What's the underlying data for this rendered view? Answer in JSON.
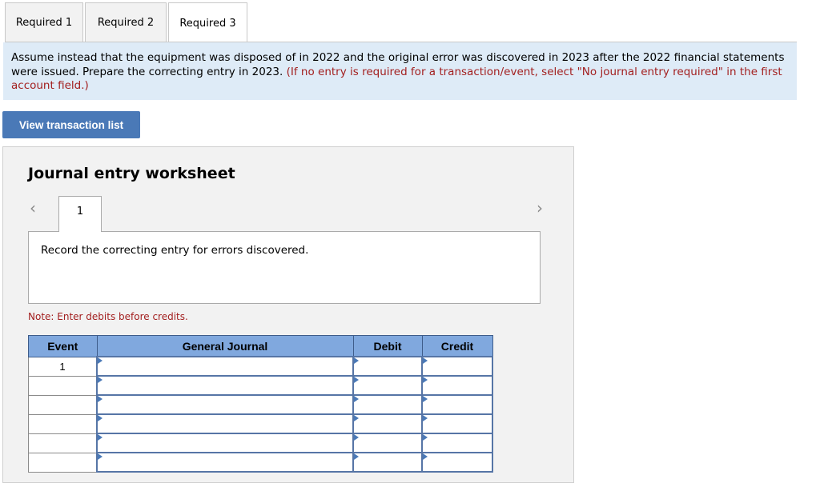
{
  "tabs": [
    {
      "label": "Required 1",
      "active": false
    },
    {
      "label": "Required 2",
      "active": false
    },
    {
      "label": "Required 3",
      "active": true
    }
  ],
  "instruction": {
    "text": "Assume instead that the equipment was disposed of in 2022 and the original error was discovered in 2023 after the 2022 financial statements were issued. Prepare the correcting entry in 2023.",
    "hint": "(If no entry is required for a transaction/event, select \"No journal entry required\" in the first account field.)"
  },
  "buttons": {
    "view_transactions": "View transaction list"
  },
  "worksheet": {
    "title": "Journal entry worksheet",
    "prev_icon": "‹",
    "next_icon": "›",
    "entry_tab": "1",
    "description": "Record the correcting entry for errors discovered.",
    "note": "Note: Enter debits before credits.",
    "table": {
      "headers": [
        "Event",
        "General Journal",
        "Debit",
        "Credit"
      ],
      "rows": [
        {
          "event": "1",
          "account": "",
          "debit": "",
          "credit": ""
        },
        {
          "event": "",
          "account": "",
          "debit": "",
          "credit": ""
        },
        {
          "event": "",
          "account": "",
          "debit": "",
          "credit": ""
        },
        {
          "event": "",
          "account": "",
          "debit": "",
          "credit": ""
        },
        {
          "event": "",
          "account": "",
          "debit": "",
          "credit": ""
        },
        {
          "event": "",
          "account": "",
          "debit": "",
          "credit": ""
        }
      ]
    }
  },
  "colors": {
    "accent": "#4a79b7",
    "header_bg": "#80a8de",
    "instruction_bg": "#deebf7",
    "hint_red": "#a32020"
  }
}
